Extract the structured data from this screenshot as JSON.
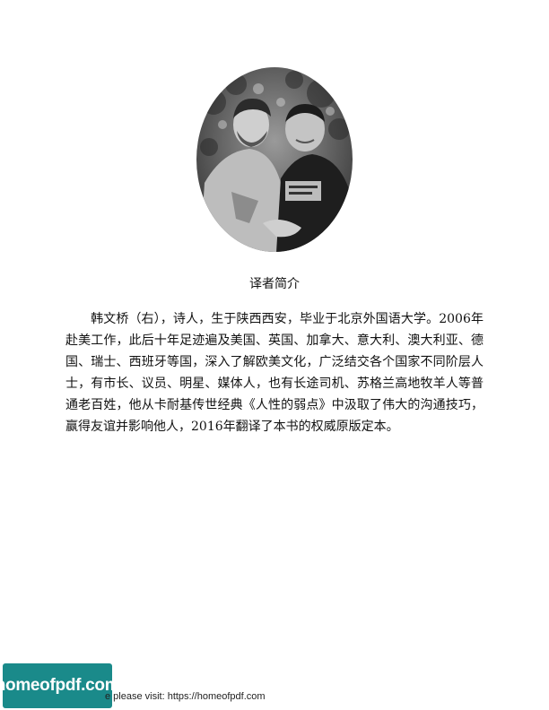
{
  "caption": "译者简介",
  "paragraph": "韩文桥（右），诗人，生于陕西西安，毕业于北京外国语大学。2006年赴美工作，此后十年足迹遍及美国、英国、加拿大、意大利、澳大利亚、德国、瑞士、西班牙等国，深入了解欧美文化，广泛结交各个国家不同阶层人士，有市长、议员、明星、媒体人，也有长途司机、苏格兰高地牧羊人等普通老百姓，他从卡耐基传世经典《人性的弱点》中汲取了伟大的沟通技巧，赢得友谊并影响他人，2016年翻译了本书的权威原版定本。",
  "footer": {
    "logo_text": "homeofpdf.com",
    "notice": "e please visit: https://homeofpdf.com"
  }
}
